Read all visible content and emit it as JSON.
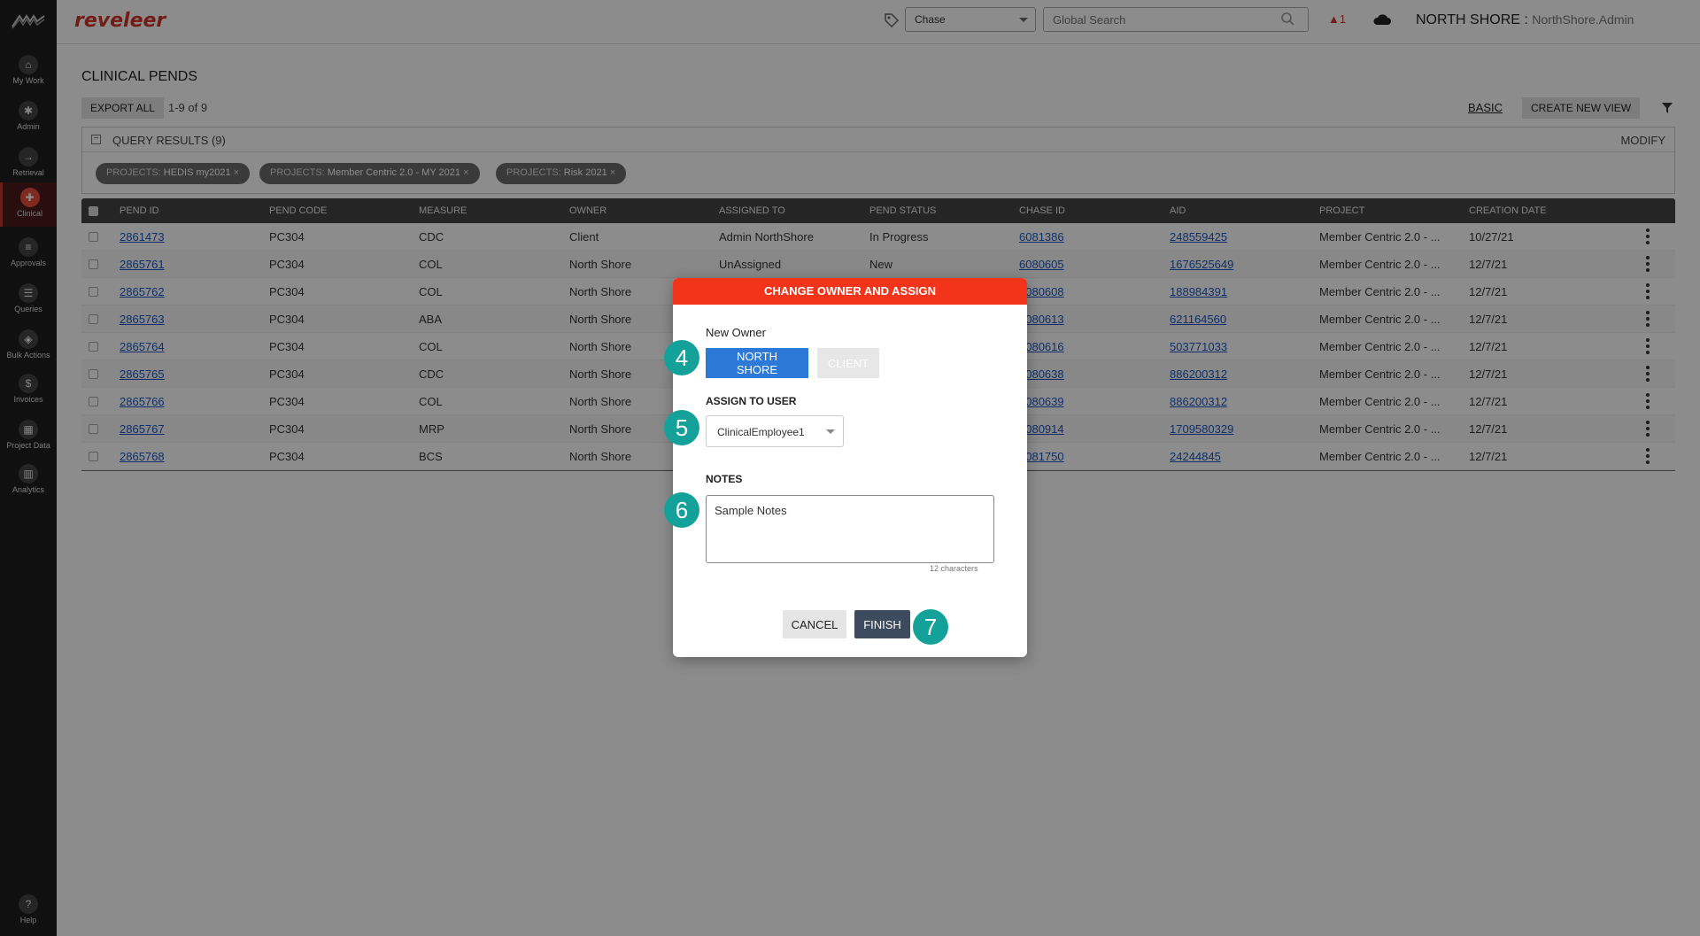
{
  "app": {
    "brand": "reveleer",
    "chase_select": "Chase",
    "search_placeholder": "Global Search",
    "notifications": "1",
    "org": "NORTH SHORE :",
    "user": "NorthShore.Admin"
  },
  "sidebar": {
    "items": [
      {
        "label": "My Work",
        "icon": "home-icon"
      },
      {
        "label": "Admin",
        "icon": "admin-icon"
      },
      {
        "label": "Retrieval",
        "icon": "arrow-icon"
      },
      {
        "label": "Clinical",
        "icon": "clinical-icon"
      },
      {
        "label": "Approvals",
        "icon": "list-icon"
      },
      {
        "label": "Queries",
        "icon": "queries-icon"
      },
      {
        "label": "Bulk Actions",
        "icon": "layers-icon"
      },
      {
        "label": "Invoices",
        "icon": "dollar-icon"
      },
      {
        "label": "Project Data",
        "icon": "data-icon"
      },
      {
        "label": "Analytics",
        "icon": "chart-icon"
      },
      {
        "label": "Help",
        "icon": "help-icon"
      }
    ]
  },
  "main": {
    "title": "CLINICAL PENDS",
    "export_all": "EXPORT ALL",
    "range": "1-9  of  9",
    "basic": "BASIC",
    "create_view": "CREATE NEW VIEW"
  },
  "query": {
    "label": "QUERY RESULTS (9)",
    "modify": "MODIFY",
    "chips": [
      {
        "key": "PROJECTS:",
        "value": "HEDIS my2021"
      },
      {
        "key": "PROJECTS:",
        "value": "Member Centric 2.0 - MY 2021"
      },
      {
        "key": "PROJECTS:",
        "value": "Risk 2021"
      }
    ]
  },
  "table": {
    "headers": [
      "PEND ID",
      "PEND CODE",
      "MEASURE",
      "OWNER",
      "ASSIGNED TO",
      "PEND STATUS",
      "CHASE ID",
      "AID",
      "PROJECT",
      "CREATION DATE"
    ],
    "rows": [
      {
        "pend_id": "2861473",
        "pend_code": "PC304",
        "measure": "CDC",
        "owner": "Client",
        "assigned": "Admin NorthShore",
        "status": "In Progress",
        "chase_id": "6081386",
        "aid": "248559425",
        "project": "Member Centric 2.0 - ...",
        "date": "10/27/21"
      },
      {
        "pend_id": "2865761",
        "pend_code": "PC304",
        "measure": "COL",
        "owner": "North Shore",
        "assigned": "UnAssigned",
        "status": "New",
        "chase_id": "6080605",
        "aid": "1676525649",
        "project": "Member Centric 2.0 - ...",
        "date": "12/7/21"
      },
      {
        "pend_id": "2865762",
        "pend_code": "PC304",
        "measure": "COL",
        "owner": "North Shore",
        "assigned": "",
        "status": "",
        "chase_id": "6080608",
        "aid": "188984391",
        "project": "Member Centric 2.0 - ...",
        "date": "12/7/21"
      },
      {
        "pend_id": "2865763",
        "pend_code": "PC304",
        "measure": "ABA",
        "owner": "North Shore",
        "assigned": "",
        "status": "",
        "chase_id": "6080613",
        "aid": "621164560",
        "project": "Member Centric 2.0 - ...",
        "date": "12/7/21"
      },
      {
        "pend_id": "2865764",
        "pend_code": "PC304",
        "measure": "COL",
        "owner": "North Shore",
        "assigned": "",
        "status": "",
        "chase_id": "6080616",
        "aid": "503771033",
        "project": "Member Centric 2.0 - ...",
        "date": "12/7/21"
      },
      {
        "pend_id": "2865765",
        "pend_code": "PC304",
        "measure": "CDC",
        "owner": "North Shore",
        "assigned": "",
        "status": "",
        "chase_id": "6080638",
        "aid": "886200312",
        "project": "Member Centric 2.0 - ...",
        "date": "12/7/21"
      },
      {
        "pend_id": "2865766",
        "pend_code": "PC304",
        "measure": "COL",
        "owner": "North Shore",
        "assigned": "",
        "status": "",
        "chase_id": "6080639",
        "aid": "886200312",
        "project": "Member Centric 2.0 - ...",
        "date": "12/7/21"
      },
      {
        "pend_id": "2865767",
        "pend_code": "PC304",
        "measure": "MRP",
        "owner": "North Shore",
        "assigned": "",
        "status": "",
        "chase_id": "6080914",
        "aid": "1709580329",
        "project": "Member Centric 2.0 - ...",
        "date": "12/7/21"
      },
      {
        "pend_id": "2865768",
        "pend_code": "PC304",
        "measure": "BCS",
        "owner": "North Shore",
        "assigned": "",
        "status": "",
        "chase_id": "6081750",
        "aid": "24244845",
        "project": "Member Centric 2.0 - ...",
        "date": "12/7/21"
      }
    ]
  },
  "modal": {
    "title": "CHANGE OWNER AND ASSIGN",
    "new_owner_label": "New Owner",
    "owner_selected": "NORTH SHORE",
    "owner_other": "CLIENT",
    "assign_label": "ASSIGN TO USER",
    "assign_value": "ClinicalEmployee1",
    "notes_label": "NOTES",
    "notes_value": "Sample Notes",
    "char_count": "12 characters",
    "cancel": "CANCEL",
    "finish": "FINISH"
  },
  "steps": [
    "4",
    "5",
    "6",
    "7"
  ],
  "colors": {
    "brand": "#d0322a",
    "modal_header": "#f2341a",
    "primary": "#2d79d8",
    "finish": "#3c4b5e",
    "step_badge": "#14a19a"
  }
}
